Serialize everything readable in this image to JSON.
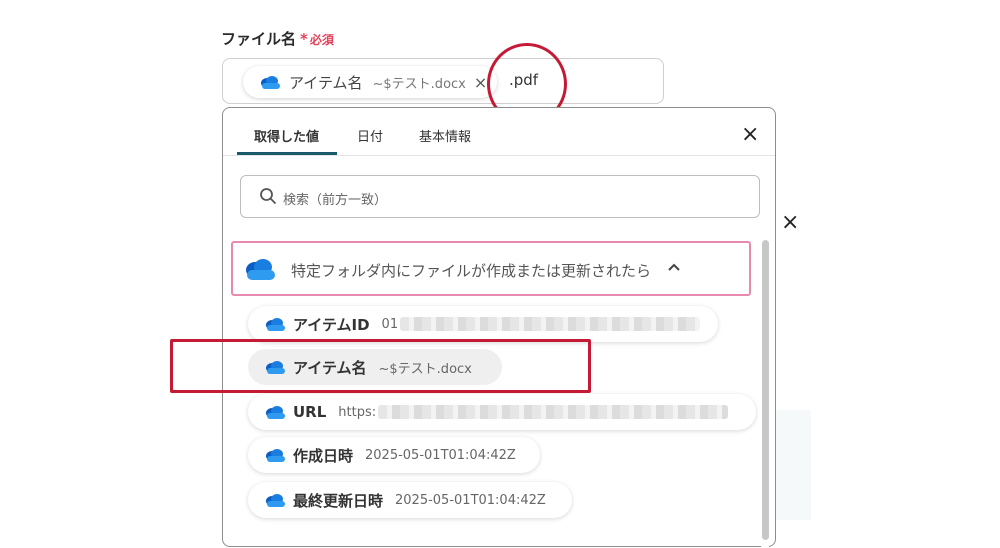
{
  "field": {
    "label": "ファイル名",
    "required_star": "*",
    "required_text": "必須",
    "chip_label": "アイテム名",
    "chip_value": "~$テスト.docx",
    "chip_remove": "×",
    "suffix": ".pdf"
  },
  "panel": {
    "tabs": [
      {
        "label": "取得した値"
      },
      {
        "label": "日付"
      },
      {
        "label": "基本情報"
      }
    ],
    "close": "×",
    "search_placeholder": "検索（前方一致）",
    "section_title": "特定フォルダ内にファイルが作成または更新されたら",
    "items": [
      {
        "label": "アイテムID",
        "value": "01"
      },
      {
        "label": "アイテム名",
        "value": "~$テスト.docx"
      },
      {
        "label": "URL",
        "value": "https:"
      },
      {
        "label": "作成日時",
        "value": "2025-05-01T01:04:42Z"
      },
      {
        "label": "最終更新日時",
        "value": "2025-05-01T01:04:42Z"
      }
    ]
  },
  "outer_close": "×",
  "colors": {
    "required": "#e2445c",
    "annotation": "#c41a36",
    "tab_underline": "#1a5b6b",
    "section_border": "#e88ab0",
    "onedrive_dark": "#0a5dc2",
    "onedrive_light": "#2e9bf0"
  },
  "icons": [
    "onedrive-cloud-icon",
    "search-icon",
    "close-icon",
    "chevron-up-icon"
  ]
}
